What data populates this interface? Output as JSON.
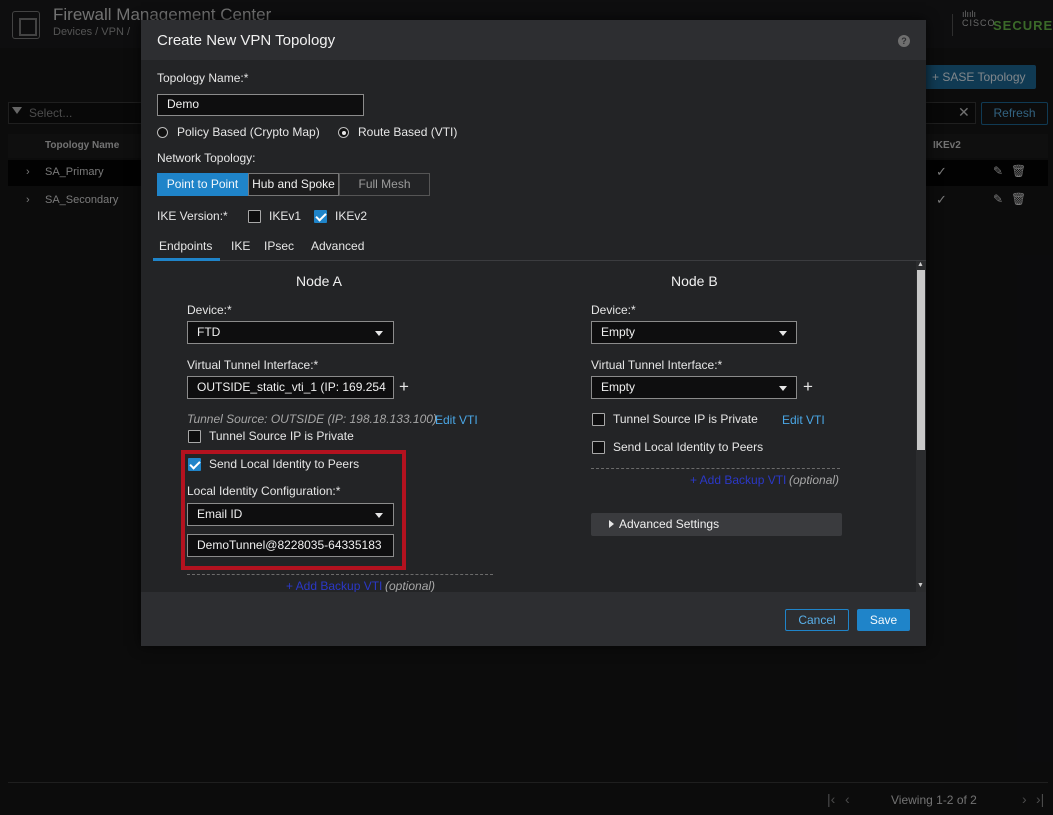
{
  "app": {
    "title": "Firewall Management Center",
    "breadcrumb": "Devices / VPN /",
    "brand_secure": "SECURE",
    "brand_cisco": "CISCO"
  },
  "page": {
    "sase_button": "+ SASE Topology",
    "filter_placeholder": "Select...",
    "clear_label": "✕",
    "refresh_button": "Refresh",
    "columns": {
      "topology_name": "Topology Name",
      "ikev2": "IKEv2"
    },
    "rows": [
      {
        "name": "SA_Primary",
        "ikev2": "✓"
      },
      {
        "name": "SA_Secondary",
        "ikev2": "✓"
      }
    ],
    "pager": {
      "text": "Viewing 1-2 of 2"
    }
  },
  "modal": {
    "title": "Create New VPN Topology",
    "help_glyph": "?",
    "topology_name_label": "Topology Name:*",
    "topology_name_value": "Demo",
    "policy_based_label": "Policy Based (Crypto Map)",
    "route_based_label": "Route Based (VTI)",
    "network_topology_label": "Network Topology:",
    "topology_options": [
      "Point to Point",
      "Hub and Spoke",
      "Full Mesh"
    ],
    "ike_version_label": "IKE Version:*",
    "ikev1_label": "IKEv1",
    "ikev2_label": "IKEv2",
    "tabs": [
      "Endpoints",
      "IKE",
      "IPsec",
      "Advanced"
    ],
    "node_a": {
      "title": "Node A",
      "device_label": "Device:*",
      "device_value": "FTD",
      "vti_label": "Virtual Tunnel Interface:*",
      "vti_value": "OUTSIDE_static_vti_1 (IP: 169.254",
      "tunnel_source": "Tunnel Source: OUTSIDE (IP: 198.18.133.100)",
      "edit_vti": "Edit VTI",
      "tunnel_private_label": "Tunnel Source IP is Private",
      "send_identity_label": "Send Local Identity to Peers",
      "local_identity_label": "Local Identity Configuration:*",
      "local_identity_type": "Email ID",
      "local_identity_value": "DemoTunnel@8228035-64335183",
      "add_backup": "+ Add Backup VTI",
      "optional": "(optional)"
    },
    "node_b": {
      "title": "Node B",
      "device_label": "Device:*",
      "device_value": "Empty",
      "vti_label": "Virtual Tunnel Interface:*",
      "vti_value": "Empty",
      "tunnel_private_label": "Tunnel Source IP is Private",
      "edit_vti": "Edit VTI",
      "send_identity_label": "Send Local Identity to Peers",
      "add_backup": "+ Add Backup VTI",
      "optional": "(optional)",
      "advanced_settings": "Advanced Settings"
    },
    "cancel_button": "Cancel",
    "save_button": "Save"
  },
  "colors": {
    "accent": "#1f84c9",
    "highlight_box": "#b3121f",
    "secure_green": "#6abf4b"
  }
}
